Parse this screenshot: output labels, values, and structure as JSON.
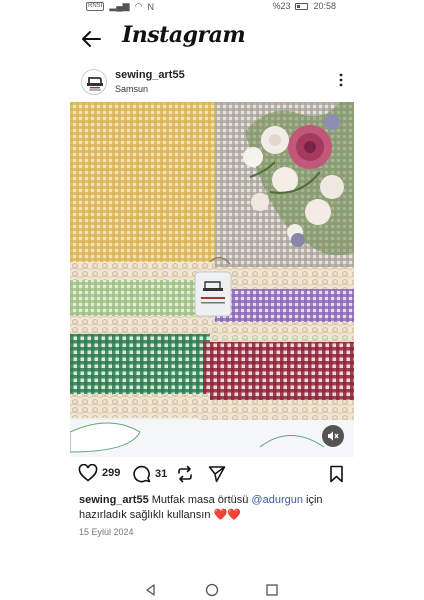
{
  "status_bar": {
    "sim_chip": "RNSI",
    "nfc": "N",
    "battery_pct": "%23",
    "time": "20:58"
  },
  "header": {
    "app_title": "Instagram"
  },
  "post": {
    "username": "sewing_art55",
    "location": "Samsun",
    "likes": "299",
    "comments": "31",
    "caption_username": "sewing_art55",
    "caption_text_1": "Mutfak masa örtüsü",
    "caption_mention": "@adurgun",
    "caption_text_2": "için hazırladık sağlıklı kullansın",
    "caption_emoji": "❤️❤️",
    "date": "15 Eylül 2024"
  },
  "colors": {
    "mustard": "#d9b154",
    "gray": "#a9a49b",
    "lightgreen": "#9fbf86",
    "purple": "#8b66b6",
    "green": "#2e7a4e",
    "burgundy": "#8c2437",
    "lace": "#e8dcc6",
    "mention": "#3b5d9b"
  },
  "icons": {
    "back": "arrow-left-icon",
    "more": "more-vertical-icon",
    "like": "heart-icon",
    "comment": "comment-icon",
    "repost": "repost-icon",
    "share": "send-icon",
    "save": "bookmark-icon",
    "mute": "muted-speaker-icon"
  }
}
